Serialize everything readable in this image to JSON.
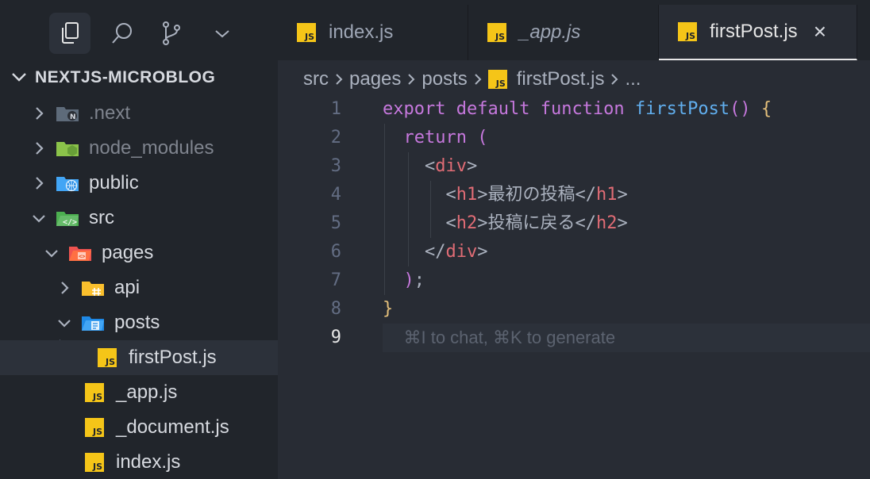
{
  "activity_bar": {
    "items": [
      "explorer-icon",
      "search-icon",
      "source-control-icon",
      "chevron-down-icon"
    ]
  },
  "explorer": {
    "title": "NEXTJS-MICROBLOG",
    "items": [
      {
        "label": ".next",
        "icon": "next-folder-icon"
      },
      {
        "label": "node_modules",
        "icon": "node-folder-icon"
      },
      {
        "label": "public",
        "icon": "public-folder-icon"
      },
      {
        "label": "src",
        "icon": "src-folder-icon"
      },
      {
        "label": "pages",
        "icon": "pages-folder-icon"
      },
      {
        "label": "api",
        "icon": "api-folder-icon"
      },
      {
        "label": "posts",
        "icon": "posts-folder-icon"
      },
      {
        "label": "firstPost.js",
        "icon": "js-file-icon"
      },
      {
        "label": "_app.js",
        "icon": "js-file-icon"
      },
      {
        "label": "_document.js",
        "icon": "js-file-icon"
      },
      {
        "label": "index.js",
        "icon": "js-file-icon"
      }
    ]
  },
  "tabs": [
    {
      "label": "index.js"
    },
    {
      "label": "_app.js"
    },
    {
      "label": "firstPost.js",
      "close": "×"
    }
  ],
  "js_badge": "JS",
  "breadcrumb": [
    "src",
    "pages",
    "posts",
    "firstPost.js",
    "..."
  ],
  "editor": {
    "line_numbers": [
      "1",
      "2",
      "3",
      "4",
      "5",
      "6",
      "7",
      "8",
      "9"
    ],
    "code": {
      "l1_export": "export",
      "l1_default": "default",
      "l1_function": "function",
      "l1_name": "firstPost",
      "l1_parens": "()",
      "l1_brace": "{",
      "l2_return": "return",
      "l2_paren": "(",
      "l3_open": "<",
      "l3_tag": "div",
      "l3_close": ">",
      "l4_tag": "h1",
      "l4_text": "最初の投稿",
      "l5_tag": "h2",
      "l5_text": "投稿に戻る",
      "l6_tag": "div",
      "l7_paren": ")",
      "l7_semi": ";",
      "l8_brace": "}"
    },
    "hint": "⌘I to chat, ⌘K to generate"
  },
  "colors": {
    "sidebar_bg": "#21252b",
    "editor_bg": "#282c34",
    "js_yellow": "#f5c518",
    "keyword": "#c678dd",
    "function": "#61afef",
    "tag": "#e06c75"
  }
}
